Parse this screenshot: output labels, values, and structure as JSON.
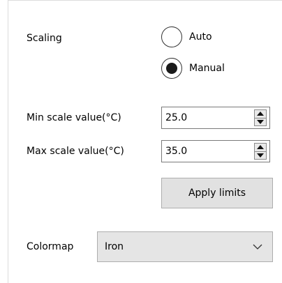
{
  "scaling": {
    "label": "Scaling",
    "options": [
      {
        "label": "Auto",
        "checked": false
      },
      {
        "label": "Manual",
        "checked": true
      }
    ]
  },
  "min_scale": {
    "label": "Min scale value(°C)",
    "value": "25.0"
  },
  "max_scale": {
    "label": "Max scale value(°C)",
    "value": "35.0"
  },
  "apply_button": {
    "label": "Apply limits"
  },
  "colormap": {
    "label": "Colormap",
    "selected": "Iron"
  },
  "icons": {
    "spin_up": "spin-up-icon",
    "spin_down": "spin-down-icon",
    "dropdown": "chevron-down-icon"
  }
}
